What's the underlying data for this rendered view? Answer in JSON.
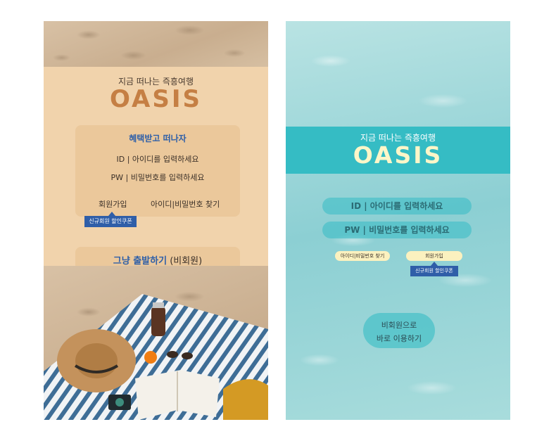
{
  "left": {
    "subtitle": "지금 떠나는 즉흥여행",
    "brand": "OASIS",
    "card_title": "혜택받고 떠나자",
    "id_field": "ID  |  아이디를 입력하세요",
    "pw_field": "PW |  비밀번호를 입력하세요",
    "signup": "회원가입",
    "find": "아이디|비밀번호 찾기",
    "coupon": "신규회원 할인쿠폰",
    "guest_main": "그냥 출발하기",
    "guest_note": " (비회원)"
  },
  "right": {
    "subtitle": "지금 떠나는 즉흥여행",
    "brand": "OASIS",
    "id_field": "ID  |   아이디를 입력하세요",
    "pw_field": "PW  |   비밀번호를 입력하세요",
    "find": "아이디|비밀번호 찾기",
    "signup": "회원가입",
    "coupon": "신규회원 할인쿠폰",
    "guest_line1": "비회원으로",
    "guest_line2": "바로 이용하기"
  },
  "colors": {
    "sand_cream": "#f1d3ac",
    "brand_orange": "#c57f44",
    "accent_blue": "#2e5fa8",
    "teal_band": "#35bcc4",
    "brand_cream": "#fdf6c8"
  }
}
